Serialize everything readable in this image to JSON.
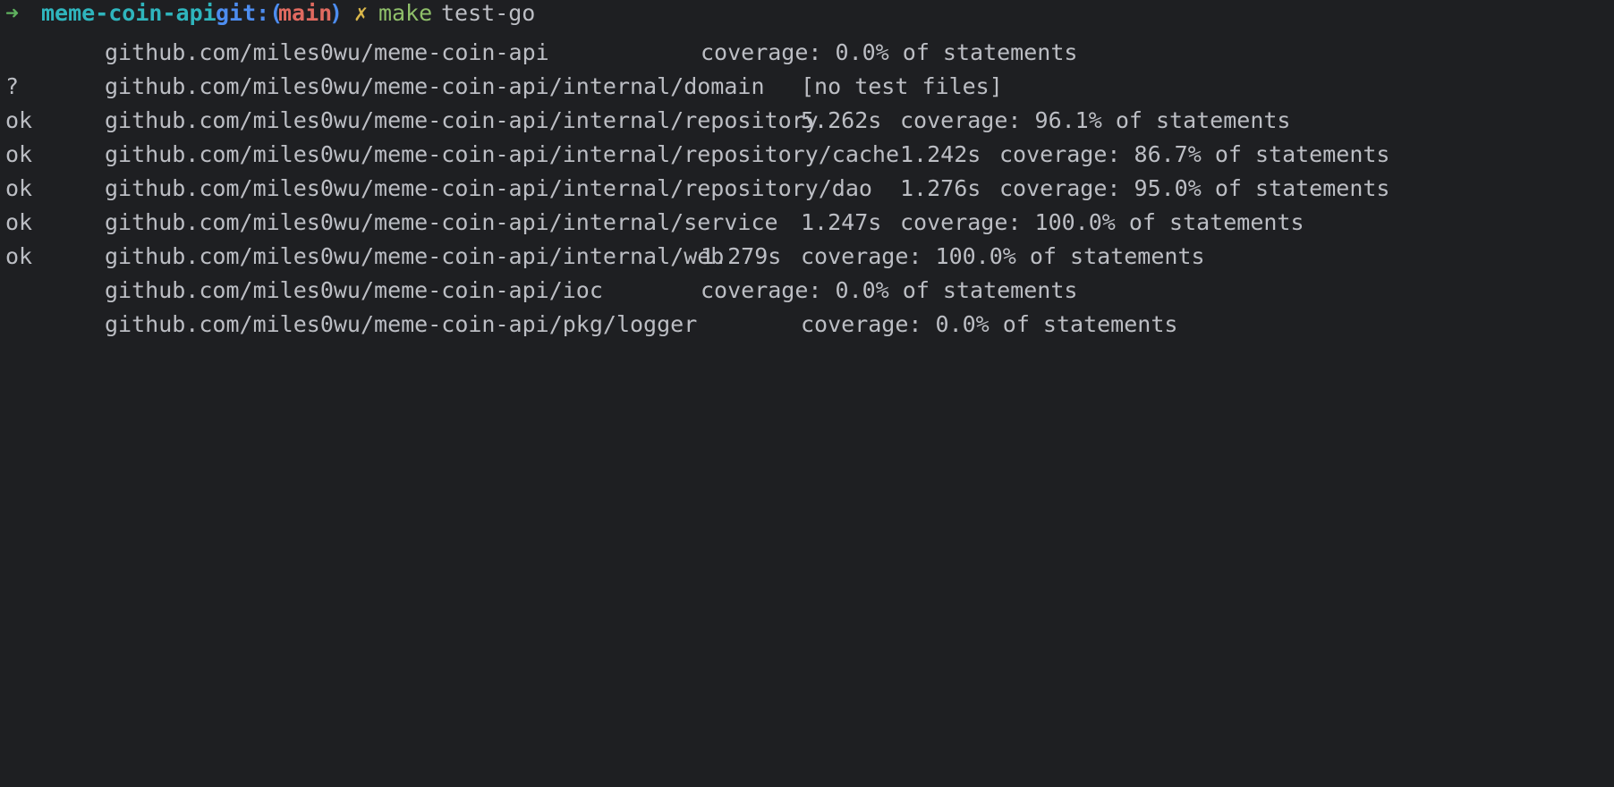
{
  "prompt": {
    "arrow": "➜",
    "directory": "meme-coin-api",
    "git_label": "git:(",
    "branch": "main",
    "git_close": ")",
    "dirty_marker": "✗",
    "command": "make",
    "command_arg": "test-go"
  },
  "results": [
    {
      "status": "",
      "package": "github.com/miles0wu/meme-coin-api",
      "time": "",
      "coverage": "coverage: 0.0% of statements"
    },
    {
      "status": "?",
      "package": "github.com/miles0wu/meme-coin-api/internal/domain",
      "time": "",
      "coverage": "[no test files]"
    },
    {
      "status": "ok",
      "package": "github.com/miles0wu/meme-coin-api/internal/repository",
      "time": "5.262s",
      "coverage": "coverage: 96.1% of statements"
    },
    {
      "status": "ok",
      "package": "github.com/miles0wu/meme-coin-api/internal/repository/cache",
      "time": "1.242s",
      "coverage": "coverage: 86.7% of statements"
    },
    {
      "status": "ok",
      "package": "github.com/miles0wu/meme-coin-api/internal/repository/dao",
      "time": "1.276s",
      "coverage": "coverage: 95.0% of statements"
    },
    {
      "status": "ok",
      "package": "github.com/miles0wu/meme-coin-api/internal/service",
      "time": "1.247s",
      "coverage": "coverage: 100.0% of statements"
    },
    {
      "status": "ok",
      "package": "github.com/miles0wu/meme-coin-api/internal/web",
      "time": "1.279s",
      "coverage": "coverage: 100.0% of statements"
    },
    {
      "status": "",
      "package": "github.com/miles0wu/meme-coin-api/ioc",
      "time": "",
      "coverage": "coverage: 0.0% of statements"
    },
    {
      "status": "",
      "package": "github.com/miles0wu/meme-coin-api/pkg/logger",
      "time": "",
      "coverage": "coverage: 0.0% of statements"
    }
  ]
}
